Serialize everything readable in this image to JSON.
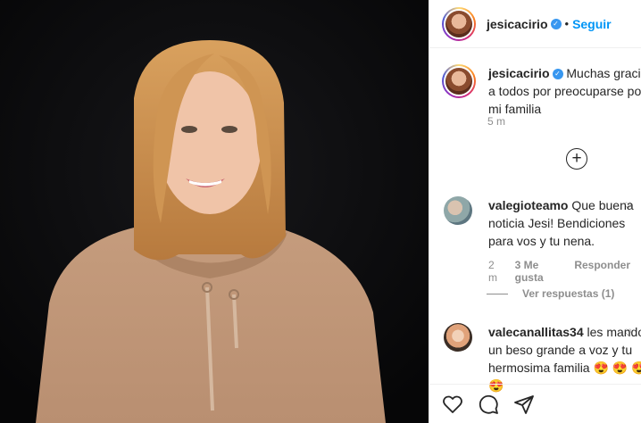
{
  "header": {
    "username": "jesicacirio",
    "separator": "•",
    "follow_label": "Seguir"
  },
  "caption": {
    "username": "jesicacirio",
    "text": "Muchas gracias a todos por preocuparse por mi familia",
    "time": "5 m"
  },
  "comments": [
    {
      "username": "valegioteamo",
      "text": "Que buena noticia Jesi! Bendiciones para vos y tu nena.",
      "time": "2 m",
      "likes": "3 Me gusta",
      "reply_label": "Responder",
      "view_replies": "Ver respuestas (1)"
    },
    {
      "username": "valecanallitas34",
      "text": "les mando un beso grande a voz y tu hermosima familia",
      "emojis": "😍 😍 😍 😍"
    }
  ],
  "icons": {
    "load_more": "plus-circle-icon",
    "like": "heart-icon",
    "comment": "comment-icon",
    "share": "share-icon",
    "verified": "verified-badge-icon"
  },
  "colors": {
    "accent": "#0095f6",
    "verified": "#3897f0",
    "media_bg": "#0b0b0d",
    "hoodie": "#c9a385"
  }
}
